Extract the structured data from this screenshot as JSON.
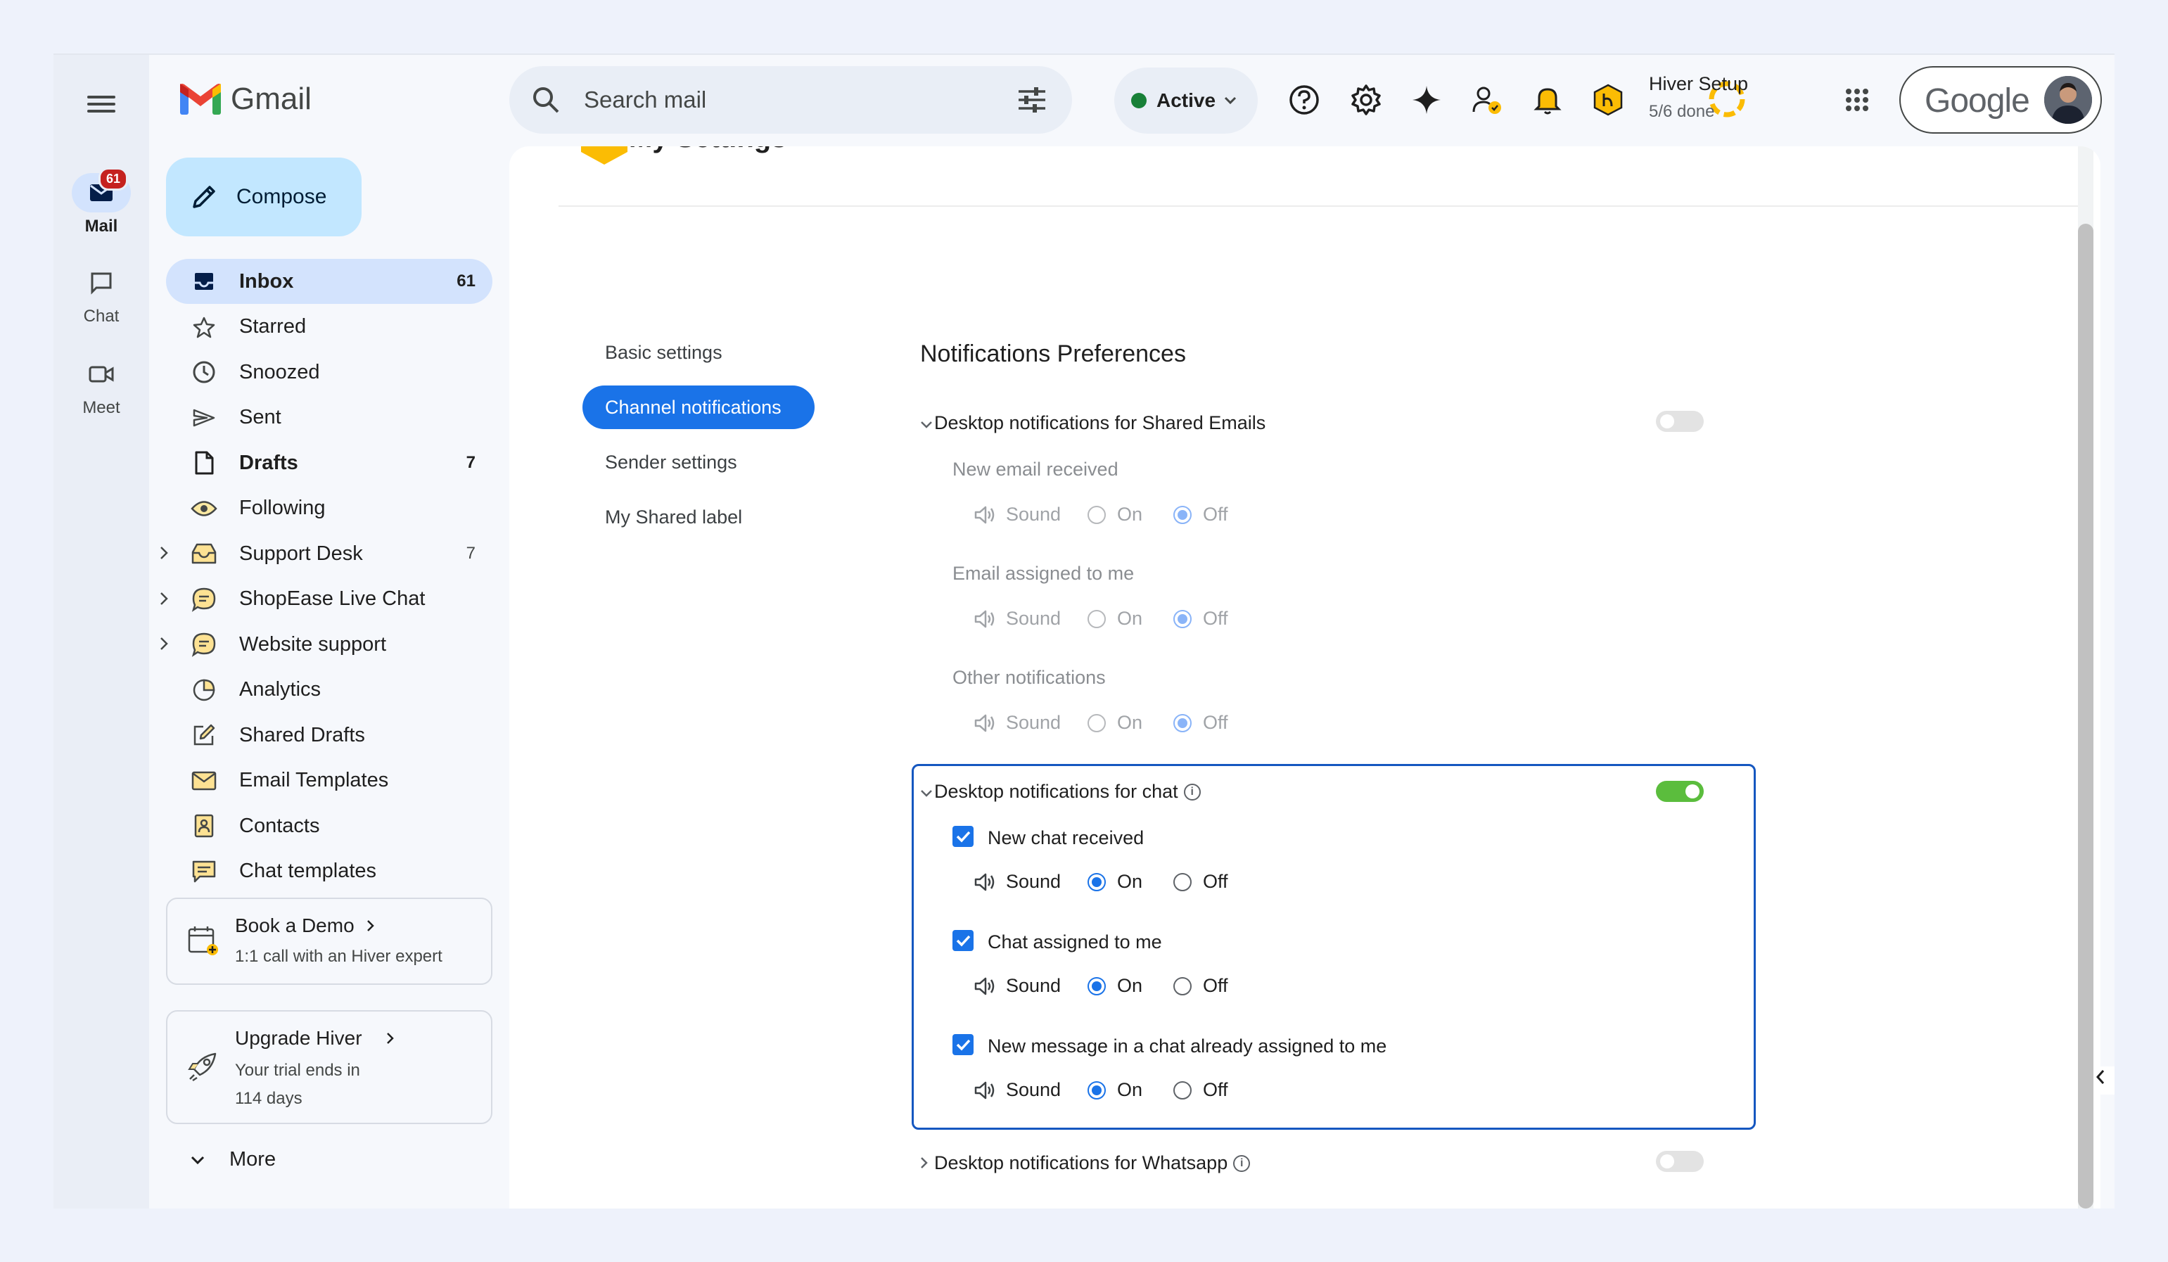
{
  "rail": {
    "mail": {
      "label": "Mail",
      "badge": "61"
    },
    "chat": {
      "label": "Chat"
    },
    "meet": {
      "label": "Meet"
    }
  },
  "header": {
    "app_name": "Gmail",
    "search_placeholder": "Search mail",
    "status_label": "Active",
    "status_color": "#188038",
    "hiver_setup_title": "Hiver Setup",
    "hiver_setup_progress": "5/6 done",
    "account_label": "Google"
  },
  "sidebar": {
    "compose_label": "Compose",
    "items": [
      {
        "label": "Inbox",
        "count": "61"
      },
      {
        "label": "Starred",
        "count": ""
      },
      {
        "label": "Snoozed",
        "count": ""
      },
      {
        "label": "Sent",
        "count": ""
      },
      {
        "label": "Drafts",
        "count": "7"
      },
      {
        "label": "Following",
        "count": ""
      },
      {
        "label": "Support Desk",
        "count": "7"
      },
      {
        "label": "ShopEase Live Chat",
        "count": ""
      },
      {
        "label": "Website support",
        "count": ""
      },
      {
        "label": "Analytics",
        "count": ""
      },
      {
        "label": "Shared Drafts",
        "count": ""
      },
      {
        "label": "Email Templates",
        "count": ""
      },
      {
        "label": "Contacts",
        "count": ""
      },
      {
        "label": "Chat templates",
        "count": ""
      }
    ],
    "demo_card": {
      "title": "Book a Demo",
      "subtitle": "1:1 call with an Hiver expert"
    },
    "upgrade_card": {
      "title": "Upgrade Hiver",
      "line1": "Your trial ends in",
      "line2": "114 days"
    },
    "more_label": "More"
  },
  "settings": {
    "page_title": "My Settings",
    "nav": [
      "Basic settings",
      "Channel notifications",
      "Sender settings",
      "My Shared label"
    ],
    "heading": "Notifications Preferences",
    "sound_label": "Sound",
    "on_label": "On",
    "off_label": "Off",
    "shared_emails": {
      "title": "Desktop notifications for Shared Emails",
      "enabled": false,
      "rows": [
        {
          "label": "New email received",
          "value": "Off"
        },
        {
          "label": "Email assigned to me",
          "value": "Off"
        },
        {
          "label": "Other notifications",
          "value": "Off"
        }
      ]
    },
    "chat": {
      "title": "Desktop notifications for chat",
      "enabled": true,
      "rows": [
        {
          "label": "New chat received",
          "checked": true,
          "value": "On"
        },
        {
          "label": "Chat assigned to me",
          "checked": true,
          "value": "On"
        },
        {
          "label": "New message in a chat already assigned to me",
          "checked": true,
          "value": "On"
        }
      ]
    },
    "whatsapp": {
      "title": "Desktop notifications for Whatsapp",
      "enabled": false
    }
  }
}
